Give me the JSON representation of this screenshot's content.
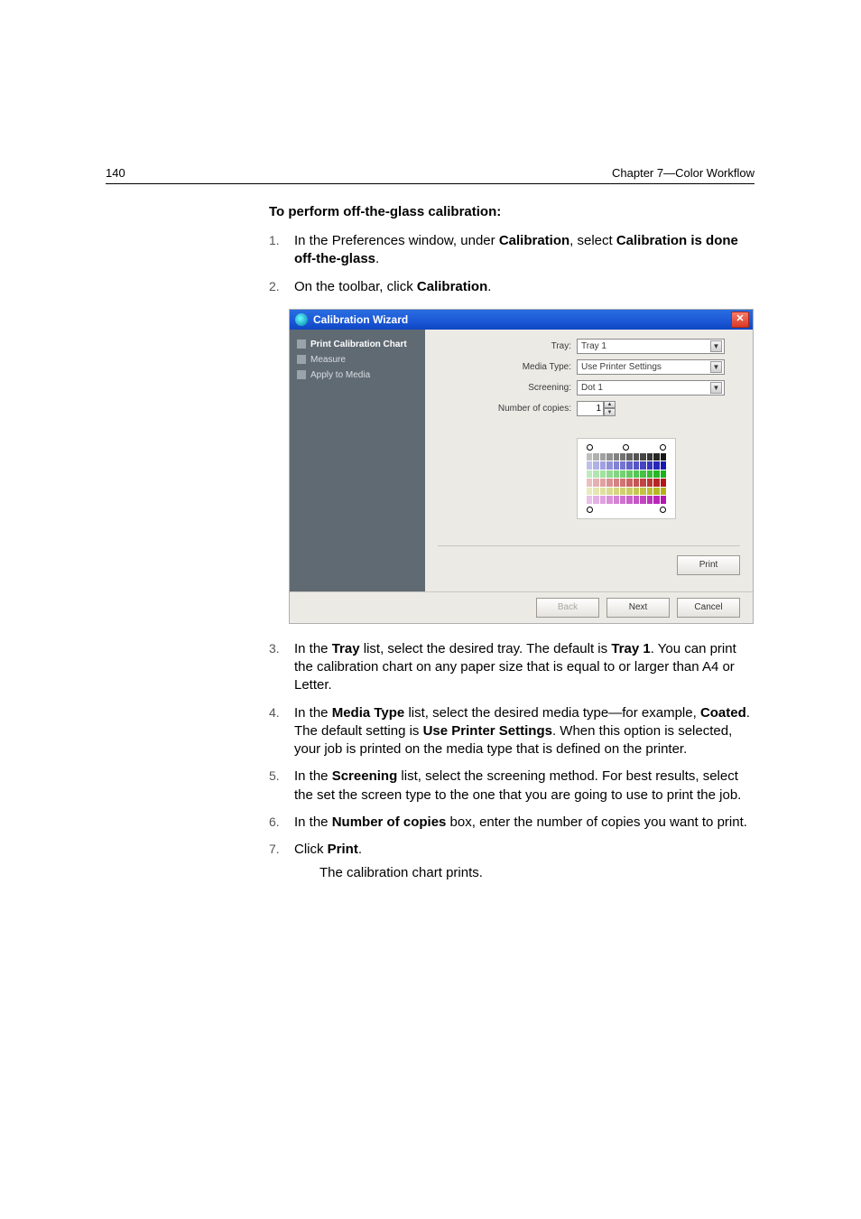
{
  "header": {
    "page_number": "140",
    "chapter": "Chapter 7—Color Workflow"
  },
  "heading": "To perform off-the-glass calibration:",
  "steps": {
    "s1": {
      "pre": "In the Preferences window, under ",
      "b1": "Calibration",
      "mid1": ", select ",
      "b2": "Calibration is done off-the-glass",
      "post": "."
    },
    "s2": {
      "pre": "On the toolbar, click ",
      "b1": "Calibration",
      "post": "."
    },
    "s3": {
      "pre": "In the ",
      "b1": "Tray",
      "mid1": " list, select the desired tray. The default is ",
      "b2": "Tray 1",
      "post": ". You can print the calibration chart on any paper size that is equal to or larger than A4 or Letter."
    },
    "s4": {
      "pre": "In the ",
      "b1": "Media Type",
      "mid1": " list, select the desired media type—for example, ",
      "b2": "Coated",
      "mid2": ". The default setting is ",
      "b3": "Use Printer Settings",
      "post": ". When this option is selected, your job is printed on the media type that is defined on the printer."
    },
    "s5": {
      "pre": "In the ",
      "b1": "Screening",
      "post": " list, select the screening method. For best results, select the set the screen type to the one that you are going to use to print the job."
    },
    "s6": {
      "pre": "In the ",
      "b1": "Number of copies",
      "post": " box, enter the number of copies you want to print."
    },
    "s7": {
      "pre": "Click ",
      "b1": "Print",
      "post": "."
    },
    "s7_body": "The calibration chart prints."
  },
  "wizard": {
    "title": "Calibration Wizard",
    "close": "✕",
    "sidebar": {
      "item1": "Print Calibration Chart",
      "item2": "Measure",
      "item3": "Apply to Media"
    },
    "form": {
      "tray_label": "Tray:",
      "tray_value": "Tray 1",
      "media_label": "Media Type:",
      "media_value": "Use Printer Settings",
      "screening_label": "Screening:",
      "screening_value": "Dot 1",
      "copies_label": "Number of copies:",
      "copies_value": "1"
    },
    "buttons": {
      "print": "Print",
      "back": "Back",
      "next": "Next",
      "cancel": "Cancel"
    }
  }
}
